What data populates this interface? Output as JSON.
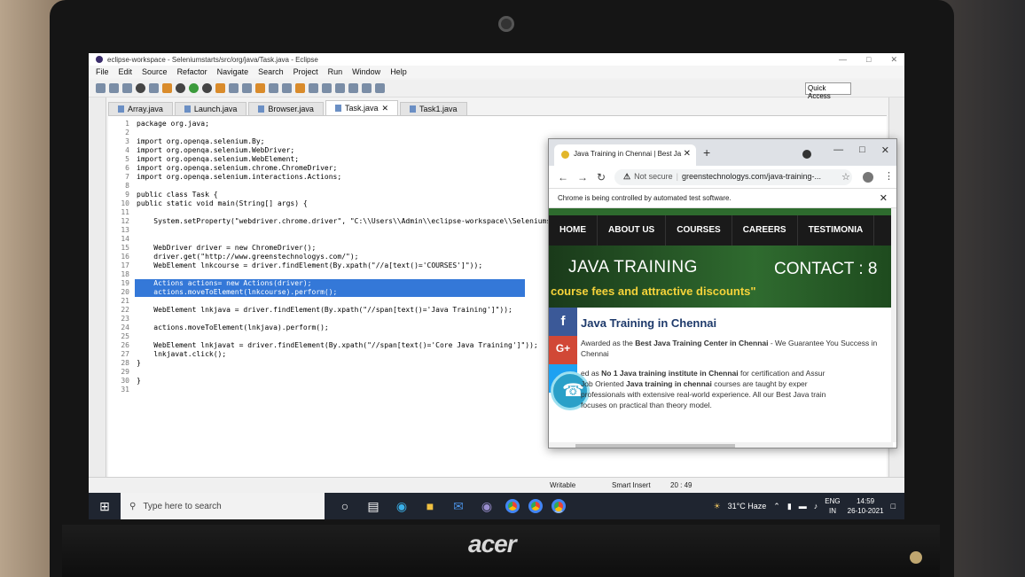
{
  "eclipse": {
    "window_title": "eclipse-workspace - Seleniumstarts/src/org/java/Task.java - Eclipse",
    "menu": [
      "File",
      "Edit",
      "Source",
      "Refactor",
      "Navigate",
      "Search",
      "Project",
      "Run",
      "Window",
      "Help"
    ],
    "quick_access": "Quick Access",
    "tabs": [
      {
        "label": "Array.java",
        "active": false
      },
      {
        "label": "Launch.java",
        "active": false
      },
      {
        "label": "Browser.java",
        "active": false
      },
      {
        "label": "Task.java",
        "active": true
      },
      {
        "label": "Task1.java",
        "active": false
      }
    ],
    "code_lines": [
      {
        "n": "1",
        "text": "package org.java;"
      },
      {
        "n": "2",
        "text": ""
      },
      {
        "n": "3",
        "text": "import org.openqa.selenium.By;"
      },
      {
        "n": "4",
        "text": "import org.openqa.selenium.WebDriver;"
      },
      {
        "n": "5",
        "text": "import org.openqa.selenium.WebElement;"
      },
      {
        "n": "6",
        "text": "import org.openqa.selenium.chrome.ChromeDriver;"
      },
      {
        "n": "7",
        "text": "import org.openqa.selenium.interactions.Actions;"
      },
      {
        "n": "8",
        "text": ""
      },
      {
        "n": "9",
        "text": "public class Task {"
      },
      {
        "n": "10",
        "text": "public static void main(String[] args) {"
      },
      {
        "n": "11",
        "text": ""
      },
      {
        "n": "12",
        "text": "    System.setProperty(\"webdriver.chrome.driver\", \"C:\\\\Users\\\\Admin\\\\eclipse-workspace\\\\Seleniums"
      },
      {
        "n": "13",
        "text": ""
      },
      {
        "n": "14",
        "text": ""
      },
      {
        "n": "15",
        "text": "    WebDriver driver = new ChromeDriver();"
      },
      {
        "n": "16",
        "text": "    driver.get(\"http://www.greenstechnologys.com/\");"
      },
      {
        "n": "17",
        "text": "    WebElement lnkcourse = driver.findElement(By.xpath(\"//a[text()='COURSES']\"));"
      },
      {
        "n": "18",
        "text": ""
      },
      {
        "n": "19",
        "text": "    Actions actions= new Actions(driver);"
      },
      {
        "n": "20",
        "text": "    actions.moveToElement(lnkcourse).perform();"
      },
      {
        "n": "21",
        "text": ""
      },
      {
        "n": "22",
        "text": "    WebElement lnkjava = driver.findElement(By.xpath(\"//span[text()='Java Training']\"));"
      },
      {
        "n": "23",
        "text": ""
      },
      {
        "n": "24",
        "text": "    actions.moveToElement(lnkjava).perform();"
      },
      {
        "n": "25",
        "text": ""
      },
      {
        "n": "26",
        "text": "    WebElement lnkjavat = driver.findElement(By.xpath(\"//span[text()='Core Java Training']\"));"
      },
      {
        "n": "27",
        "text": "    lnkjavat.click();"
      },
      {
        "n": "28",
        "text": "}"
      },
      {
        "n": "29",
        "text": ""
      },
      {
        "n": "30",
        "text": "}"
      },
      {
        "n": "31",
        "text": ""
      }
    ],
    "selected_lines": [
      "19",
      "20"
    ],
    "status": {
      "mode": "Writable",
      "insert": "Smart Insert",
      "position": "20 : 49"
    }
  },
  "chrome": {
    "tab_title": "Java Training in Chennai | Best Ja",
    "not_secure": "Not secure",
    "url": "greenstechnologys.com/java-training-...",
    "infobar": "Chrome is being controlled by automated test software.",
    "page": {
      "nav": [
        "HOME",
        "ABOUT US",
        "COURSES",
        "CAREERS",
        "TESTIMONIA"
      ],
      "banner_left": "JAVA TRAINING",
      "banner_right": "CONTACT : 8",
      "banner_fees": "course fees and attractive discounts\"",
      "heading": "Java Training in Chennai",
      "p1_pre": "Awarded as the ",
      "p1_bold": "Best Java Training Center in Chennai",
      "p1_post": " - We Guarantee You Success in Chennai",
      "p2_pre": "ed as ",
      "p2_bold": "No 1 Java training institute in Chennai",
      "p2_post": " for certification and Assur",
      "p3_pre": "Job Oriented ",
      "p3_bold": "Java training in chennai",
      "p3_post": " courses are taught by exper",
      "p4": "professionals with extensive real-world experience. All our Best Java train",
      "p5": "focuses on practical than theory model."
    }
  },
  "taskbar": {
    "search_placeholder": "Type here to search",
    "weather": "31°C  Haze",
    "lang1": "ENG",
    "lang2": "IN",
    "time": "14:59",
    "date": "26-10-2021"
  },
  "hardware": {
    "brand": "acer"
  }
}
